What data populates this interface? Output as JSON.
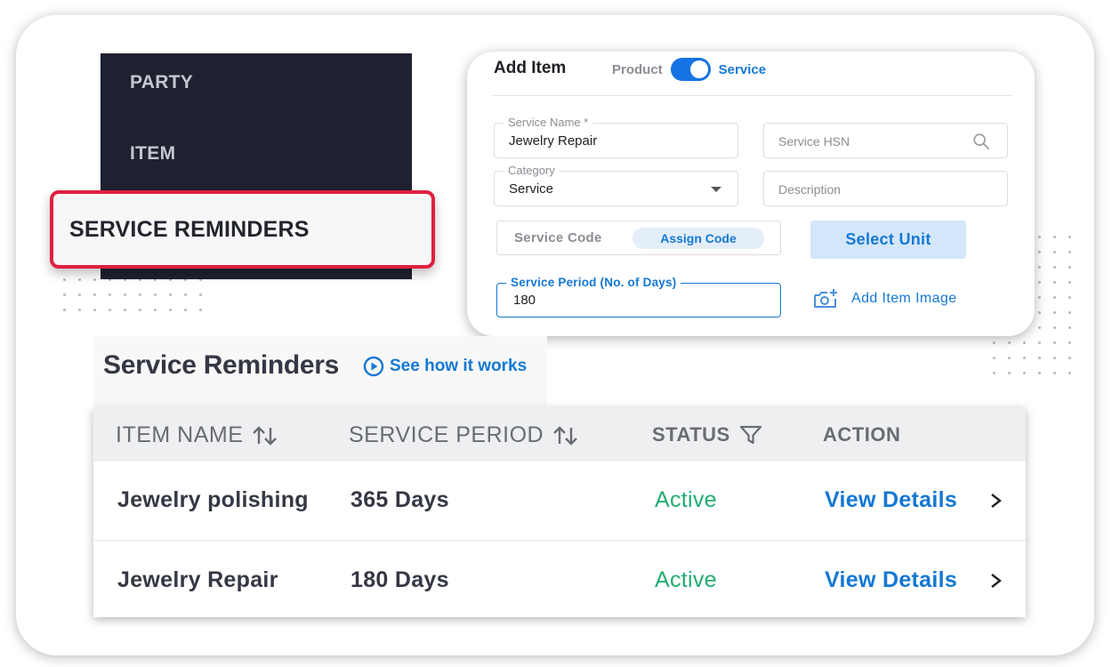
{
  "sidebar": {
    "items": [
      {
        "label": "PARTY"
      },
      {
        "label": "ITEM"
      },
      {
        "label": "SERVICE REMINDERS",
        "highlighted": true
      }
    ]
  },
  "add_item": {
    "title": "Add Item",
    "toggle": {
      "left_label": "Product",
      "right_label": "Service",
      "selected": "Service"
    },
    "fields": {
      "service_name": {
        "label": "Service Name *",
        "value": "Jewelry Repair"
      },
      "service_hsn": {
        "placeholder": "Service HSN"
      },
      "category": {
        "label": "Category",
        "value": "Service"
      },
      "description": {
        "placeholder": "Description"
      },
      "service_code": {
        "placeholder": "Service Code",
        "button": "Assign Code"
      },
      "service_period": {
        "label": "Service Period (No. of Days)",
        "value": "180"
      }
    },
    "select_unit_label": "Select Unit",
    "add_image_label": "Add Item Image"
  },
  "service_reminders": {
    "title": "Service Reminders",
    "help_link": "See how it works",
    "table": {
      "columns": [
        {
          "label": "ITEM NAME",
          "icon": "sort-icon"
        },
        {
          "label": "SERVICE PERIOD",
          "icon": "sort-icon"
        },
        {
          "label": "STATUS",
          "icon": "filter-icon"
        },
        {
          "label": "ACTION"
        }
      ],
      "rows": [
        {
          "item_name": "Jewelry polishing",
          "service_period": "365 Days",
          "status": "Active",
          "action": "View Details"
        },
        {
          "item_name": "Jewelry Repair",
          "service_period": "180 Days",
          "status": "Active",
          "action": "View Details"
        }
      ]
    }
  },
  "colors": {
    "accent": "#1478d4",
    "highlight_border": "#e0203f",
    "sidebar_bg": "#1e2130",
    "status_active": "#22ad72"
  }
}
